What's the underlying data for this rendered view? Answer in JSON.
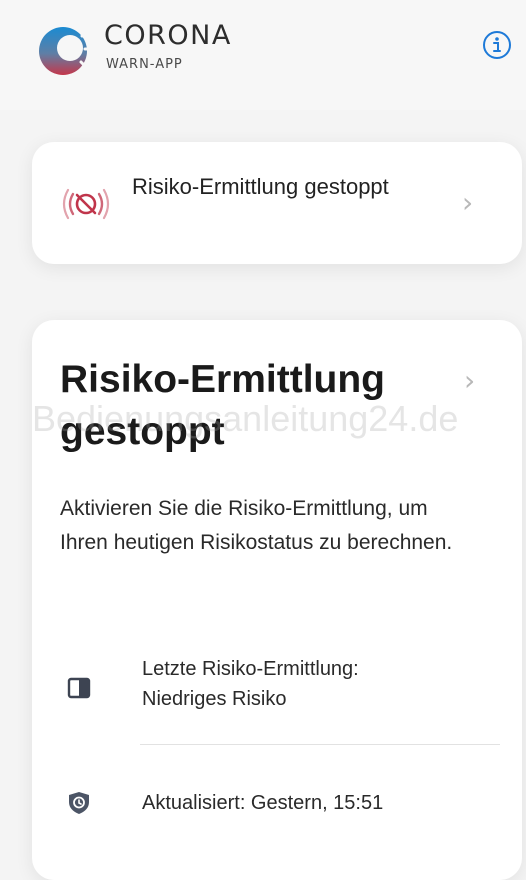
{
  "header": {
    "brand_name": "CORONA",
    "brand_sub": "WARN-APP",
    "logo_icon": "corona-virus-logo-icon",
    "info_icon": "info-circle-icon"
  },
  "status_card": {
    "title": "Risiko-Ermittlung gestoppt",
    "icon": "tracing-stopped-icon",
    "chevron_icon": "chevron-right-icon"
  },
  "risk_card": {
    "title": "Risiko-Ermittlung gestoppt",
    "chevron_icon": "chevron-right-icon",
    "watermark": "Bedienungsanleitung24.de",
    "description": "Aktivieren Sie die Risiko-Ermittlung, um Ihren heutigen Risikostatus zu berechnen.",
    "last_check_line1": "Letzte Risiko-Ermittlung:",
    "last_check_line2": "Niedriges Risiko",
    "last_check_icon": "half-filled-square-icon",
    "updated_text": "Aktualisiert: Gestern, 15:51",
    "updated_icon": "shield-clock-icon"
  },
  "colors": {
    "accent_blue": "#1E7AD8",
    "stopped_red": "#C0354B",
    "icon_dark": "#4C5566"
  }
}
